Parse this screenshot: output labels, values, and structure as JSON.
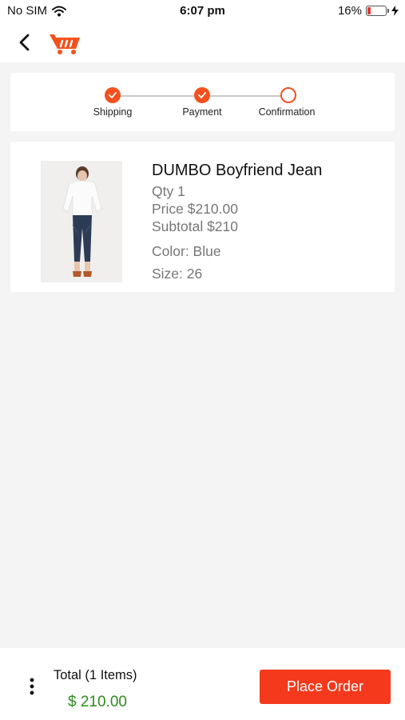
{
  "status": {
    "carrier": "No SIM",
    "time": "6:07 pm",
    "battery": "16%",
    "battery_level": 0.16
  },
  "nav": {
    "back_icon": "chevron-left-icon",
    "logo_icon": "shopping-cart-logo-icon"
  },
  "steps": [
    {
      "label": "Shipping",
      "state": "done"
    },
    {
      "label": "Payment",
      "state": "done"
    },
    {
      "label": "Confirmation",
      "state": "pending"
    }
  ],
  "item": {
    "name": "DUMBO Boyfriend Jean",
    "qty": "Qty 1",
    "price": "Price $210.00",
    "subtotal": "Subtotal $210",
    "color": "Color: Blue",
    "size": "Size: 26"
  },
  "footer": {
    "total_label": "Total (1 Items)",
    "total_amount": "$ 210.00",
    "place_order": "Place Order"
  },
  "colors": {
    "accent": "#f4391c",
    "step_accent": "#f4511e",
    "total_green": "#2e8b1e"
  }
}
